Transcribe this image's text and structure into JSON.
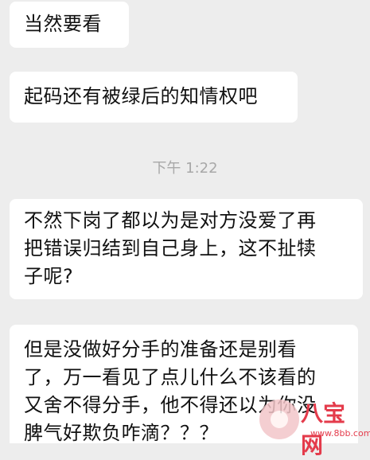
{
  "messages": [
    {
      "text": "当然要看"
    },
    {
      "text": "起码还有被绿后的知情权吧"
    },
    {
      "text": "不然下岗了都以为是对方没爱了再\n把错误归结到自己身上，这不扯犊\n子呢?"
    },
    {
      "text": "但是没做好分手的准备还是别看\n了，万一看见了点儿什么不该看的\n又舍不得分手，他不得还以为你没\n脾气好欺负咋滴？？？"
    }
  ],
  "timestamp": "下午 1:22",
  "watermark": {
    "brand": "八宝网",
    "url": "www.8bb.com"
  },
  "colors": {
    "background": "#ededed",
    "bubble": "#ffffff",
    "timestamp": "#a8a8a8",
    "watermark": "#e43b4b"
  }
}
